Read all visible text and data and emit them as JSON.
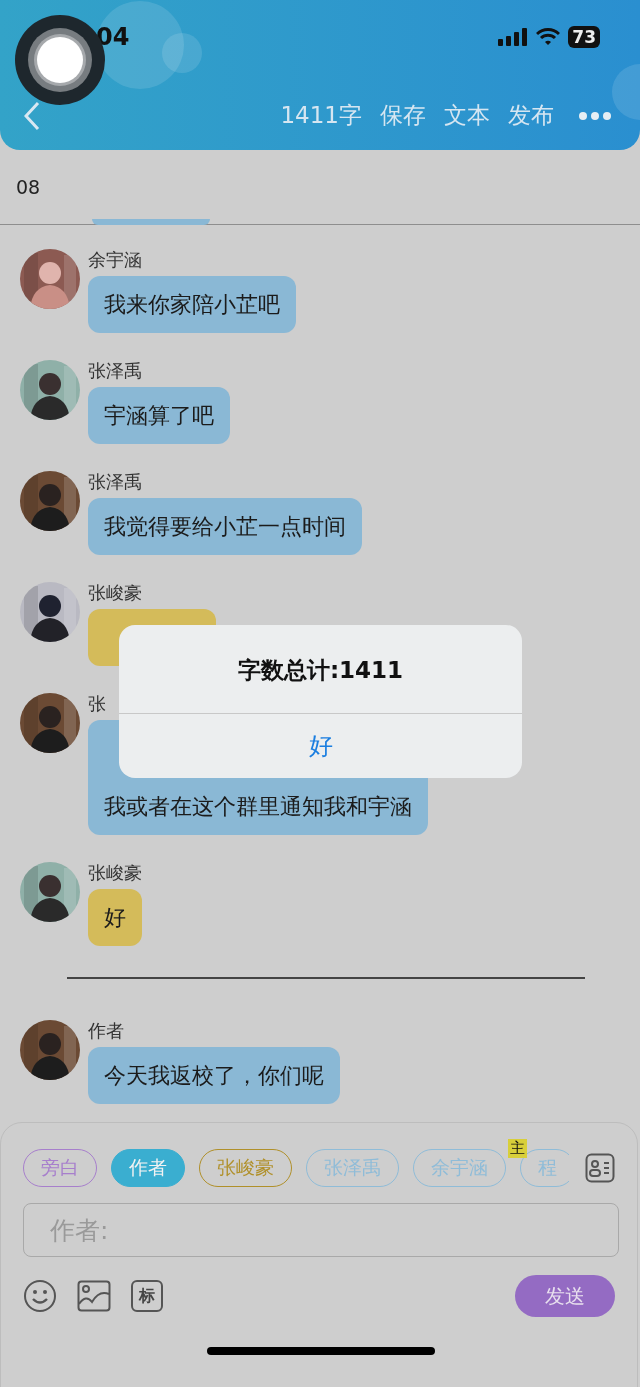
{
  "status_bar": {
    "time": "04",
    "battery": "73"
  },
  "header": {
    "word_count": "1411字",
    "actions": [
      "保存",
      "文本",
      "发布"
    ]
  },
  "subheader": {
    "text": "08"
  },
  "messages": [
    {
      "kind": "message",
      "sender": "余宇涵",
      "lines": [
        "我来你家陪小芷吧"
      ],
      "color": "#8ab8d5"
    },
    {
      "kind": "message",
      "sender": "张泽禹",
      "lines": [
        "宇涵算了吧"
      ],
      "color": "#8ab8d5"
    },
    {
      "kind": "message",
      "sender": "张泽禹",
      "lines": [
        "我觉得要给小芷一点时间"
      ],
      "color": "#8ab8d5"
    },
    {
      "kind": "message",
      "sender": "张峻豪",
      "color": "#d4bb5a"
    },
    {
      "kind": "message",
      "sender": "张",
      "covered": true,
      "lines": [
        "我或者在这个群里通知我和宇涵"
      ],
      "color": "#8ab8d5"
    },
    {
      "kind": "message",
      "sender": "张峻豪",
      "lines": [
        "好"
      ],
      "color": "#d4bb5a"
    },
    {
      "kind": "divider"
    },
    {
      "kind": "message",
      "sender": "作者",
      "lines": [
        "今天我返校了，你们呢"
      ],
      "color": "#8ab8d5"
    }
  ],
  "roles": [
    {
      "label": "旁白",
      "color": "#a77fcc",
      "selected": false
    },
    {
      "label": "作者",
      "color": "#3aaed0",
      "selected": true
    },
    {
      "label": "张峻豪",
      "color": "#b0902a",
      "selected": false
    },
    {
      "label": "张泽禹",
      "color": "#8fbcd8",
      "selected": false
    },
    {
      "label": "余宇涵",
      "color": "#8fbcd8",
      "selected": false
    },
    {
      "label": "程",
      "color": "#8fbcd8",
      "selected": false,
      "badge": "主"
    }
  ],
  "input": {
    "placeholder": "作者:"
  },
  "send_button": "发送",
  "tag_button": "标",
  "alert": {
    "title": "字数总计:1411",
    "button": "好"
  }
}
